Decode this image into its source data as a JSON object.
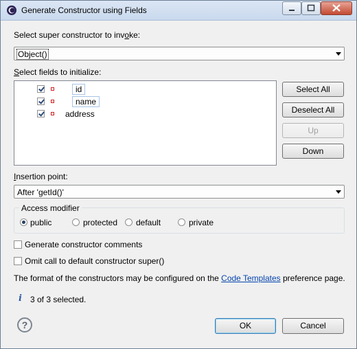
{
  "window": {
    "title": "Generate Constructor using Fields"
  },
  "super": {
    "label_pre": "Select super constructor to inv",
    "label_acc": "o",
    "label_post": "ke:",
    "selected": "Object()"
  },
  "fields": {
    "label_acc": "S",
    "label_post": "elect fields to initialize:",
    "items": [
      {
        "name": "id",
        "checked": true
      },
      {
        "name": "name",
        "checked": true
      },
      {
        "name": "address",
        "checked": true
      }
    ]
  },
  "buttons": {
    "select_all": "Select All",
    "deselect_all": "Deselect All",
    "up": "Up",
    "down": "Down"
  },
  "insertion": {
    "label_acc": "I",
    "label_post": "nsertion point:",
    "selected": "After 'getId()'"
  },
  "access": {
    "title": "Access modifier",
    "options": [
      {
        "label": "public",
        "checked": true
      },
      {
        "label": "protected",
        "checked": false
      },
      {
        "label": "default",
        "checked": false
      },
      {
        "label": "private",
        "checked": false
      }
    ]
  },
  "options": {
    "gen_comments": "Generate constructor comments",
    "omit_super": "Omit call to default constructor super()"
  },
  "footer_text": {
    "pre": "The format of the constructors may be configured on the ",
    "link": "Code Templates",
    "post": " preference page."
  },
  "status": "3 of 3 selected.",
  "dialog_buttons": {
    "ok": "OK",
    "cancel": "Cancel"
  },
  "icons": {
    "app": "eclipse-icon",
    "minimize": "minimize-icon",
    "maximize": "maximize-icon",
    "close": "close-icon",
    "field": "field-private-icon",
    "info": "info-icon",
    "help": "help-icon"
  }
}
